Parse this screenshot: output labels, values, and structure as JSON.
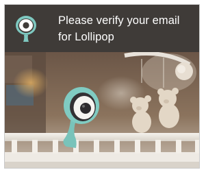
{
  "notification": {
    "icon": "baby-camera-icon",
    "message": "Please verify your email for Lollipop",
    "accent_color": "#7ec8c0",
    "background_color": "#3f3b38"
  },
  "photo": {
    "subject": "baby-monitor-camera-on-crib-photo"
  }
}
